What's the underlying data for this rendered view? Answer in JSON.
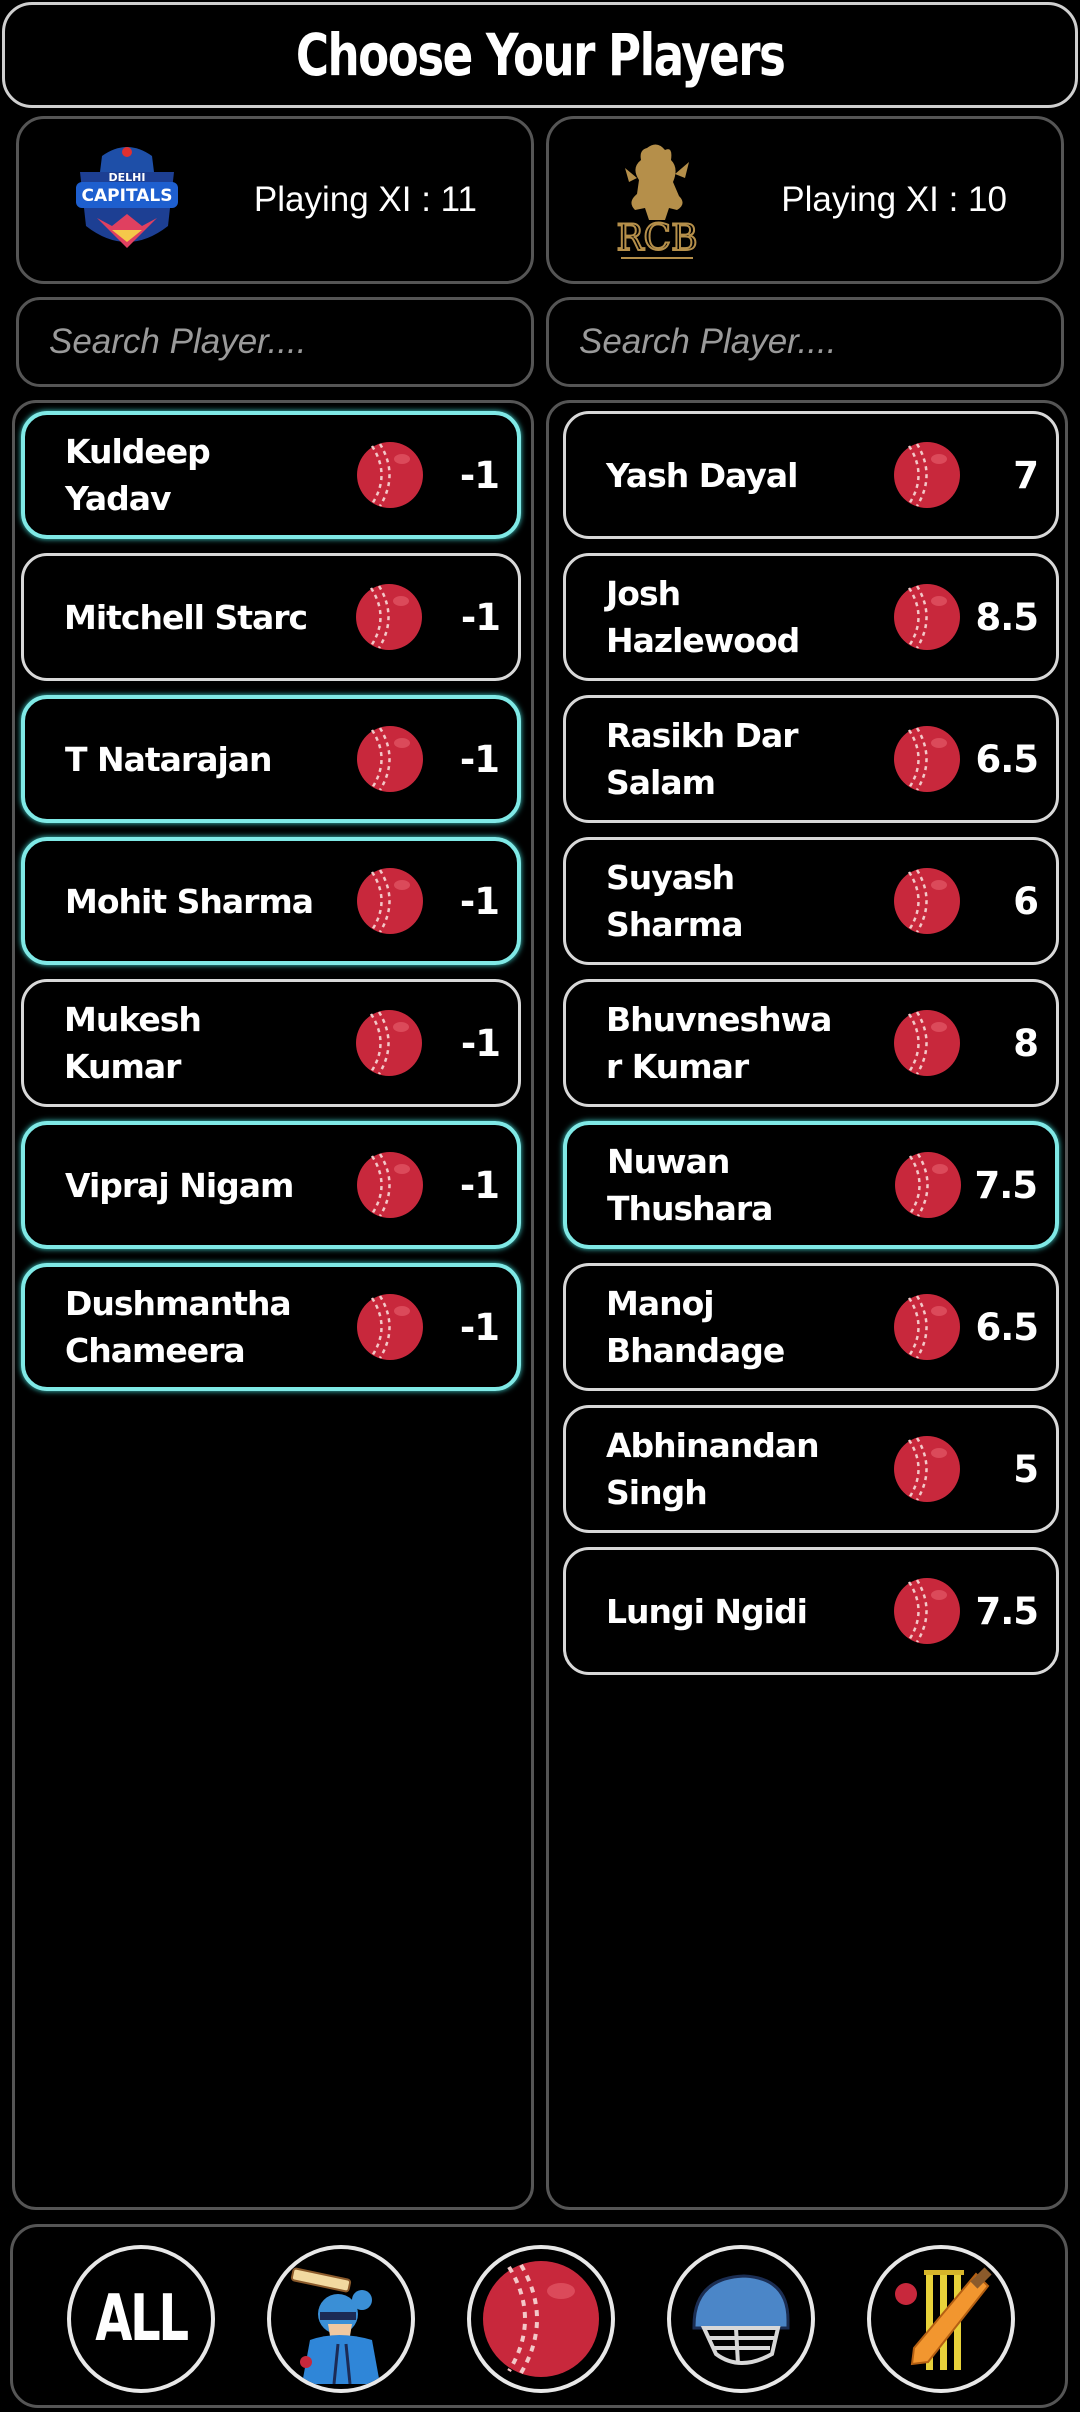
{
  "title": "Choose Your Players",
  "teams": [
    {
      "logo": "delhi-capitals-logo",
      "logo_text": "DELHI CAPITALS",
      "playing_xi": "Playing XI : 11",
      "search_placeholder": "Search Player...."
    },
    {
      "logo": "rcb-logo",
      "logo_text": "RCB",
      "playing_xi": "Playing XI : 10",
      "search_placeholder": "Search Player...."
    }
  ],
  "lists": [
    [
      {
        "name": "Kuldeep Yadav",
        "value": "-1",
        "selected": true
      },
      {
        "name": "Mitchell Starc",
        "value": "-1",
        "selected": false
      },
      {
        "name": "T Natarajan",
        "value": "-1",
        "selected": true
      },
      {
        "name": "Mohit Sharma",
        "value": "-1",
        "selected": true
      },
      {
        "name": "Mukesh Kumar",
        "value": "-1",
        "selected": false
      },
      {
        "name": "Vipraj Nigam",
        "value": "-1",
        "selected": true
      },
      {
        "name": "Dushmantha Chameera",
        "value": "-1",
        "selected": true
      }
    ],
    [
      {
        "name": "Yash Dayal",
        "value": "7",
        "selected": false
      },
      {
        "name": "Josh Hazlewood",
        "value": "8.5",
        "selected": false
      },
      {
        "name": "Rasikh Dar Salam",
        "value": "6.5",
        "selected": false
      },
      {
        "name": "Suyash Sharma",
        "value": "6",
        "selected": false
      },
      {
        "name": "Bhuvneshwar Kumar",
        "value": "8",
        "selected": false
      },
      {
        "name": "Nuwan Thushara",
        "value": "7.5",
        "selected": true
      },
      {
        "name": "Manoj Bhandage",
        "value": "6.5",
        "selected": false
      },
      {
        "name": "Abhinandan Singh",
        "value": "5",
        "selected": false
      },
      {
        "name": "Lungi Ngidi",
        "value": "7.5",
        "selected": false
      }
    ]
  ],
  "role_icon": "cricket-ball-icon",
  "filters": [
    {
      "label": "ALL",
      "icon": "all"
    },
    {
      "label": "",
      "icon": "batter-icon"
    },
    {
      "label": "",
      "icon": "cricket-ball-icon"
    },
    {
      "label": "",
      "icon": "helmet-icon"
    },
    {
      "label": "",
      "icon": "bat-stumps-icon"
    }
  ],
  "colors": {
    "selected_border": "#7fe9e6",
    "ball": "#c8283c",
    "panel_border": "#555555"
  }
}
